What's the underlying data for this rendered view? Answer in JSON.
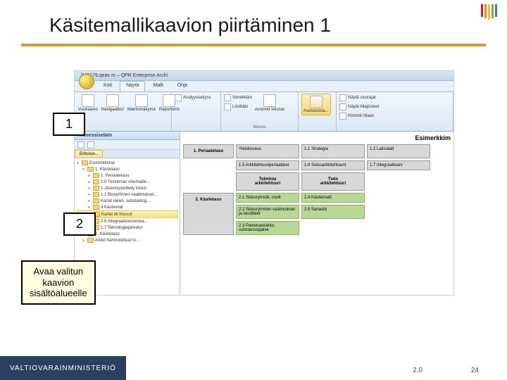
{
  "title": "Käsitemallikaavion piirtäminen 1",
  "markers": {
    "m1": "1",
    "m2": "2"
  },
  "callout": "Avaa valitun\nkaavion\nsisältöalueelle",
  "app": {
    "titlebar": "JHS179.qeax m – QPR Enterprise Archi",
    "tabs": [
      "Koti",
      "Näytä",
      "Malli",
      "Ohje"
    ],
    "active_tab": 1,
    "ribbon": {
      "g1": {
        "items": [
          "Vuokaavio",
          "Navigaattori",
          "Matriisinäkymä",
          "Raportointi"
        ],
        "label": ""
      },
      "g2": {
        "items": [
          "Analyysiarkyra"
        ],
        "label": ""
      },
      "g3": {
        "items": [
          "Vierekkäin",
          "Limittäin",
          "Avoimet ikkunat"
        ],
        "label": "Ikkuna"
      },
      "g4": {
        "items": [
          "Asetuksista..."
        ],
        "label": ""
      },
      "g5": {
        "items": [
          "Näytä sivurajat",
          "Näytä hilapisteet",
          "Kiinnitä hilaan"
        ],
        "label": ""
      }
    },
    "sidebar": {
      "title": "Prosessiselain",
      "tab": "Erikoisa...",
      "tree": [
        {
          "d": 0,
          "t": "Esimerkkimal"
        },
        {
          "d": 1,
          "t": "1. Käsitetaso"
        },
        {
          "d": 2,
          "t": "1. Periaatetaso"
        },
        {
          "d": 2,
          "t": "2.0 Toiminnan viitemallin..."
        },
        {
          "d": 2,
          "t": "1 Jäsennyserittely toisiin"
        },
        {
          "d": 2,
          "t": "1.2 Biosyrhmen vaatimukset..."
        },
        {
          "d": 2,
          "t": "Kartat raken, substantsg..."
        },
        {
          "d": 2,
          "t": "4 Käsitemat",
          "sel": false
        },
        {
          "d": 2,
          "t": "Kartat eli housut",
          "sel": true
        },
        {
          "d": 2,
          "t": "2.6 Integraatioarvoreka..."
        },
        {
          "d": 2,
          "t": "1.7 Teknologiapalvelut"
        },
        {
          "d": 1,
          "t": "2. Käsitetaso"
        },
        {
          "d": 1,
          "t": "Arkkit hahmoteltuat to..."
        }
      ]
    },
    "content": {
      "header": "Esimerkkim",
      "row1_label": "1. Periaatetaso",
      "row1": [
        "Yleiskuvaus",
        "1.1 Strategia",
        "1.2 Lainsääd"
      ],
      "row1b": [
        "1.5 Arkkitehtuuriperiaatteet",
        "1.6 Sidosarkkitehtuurit",
        "1.7 Integraatioarv"
      ],
      "heads": [
        "Toiminta\narkkitehtuuri",
        "Tieto\narkkitehtuuri"
      ],
      "row2": [
        [
          "2.1 Sidosryhmät, roolit",
          "2.4 Käsitemalli"
        ],
        [
          "2.2 Sidosryhmien vaatimukset ja tavoitteet",
          "2.5 Sanasto"
        ],
        [
          "2.3 Palveluasiakku, substanssipalve",
          ""
        ]
      ],
      "row2_label": "2. Käsitetaso"
    }
  },
  "footer": {
    "org": "VALTIOVARAINMINISTERIÖ",
    "version": "2.0",
    "page": "24"
  },
  "stripes": [
    "#c02030",
    "#e88820",
    "#f0c030",
    "#88b030",
    "#3080c0",
    "#505080"
  ]
}
